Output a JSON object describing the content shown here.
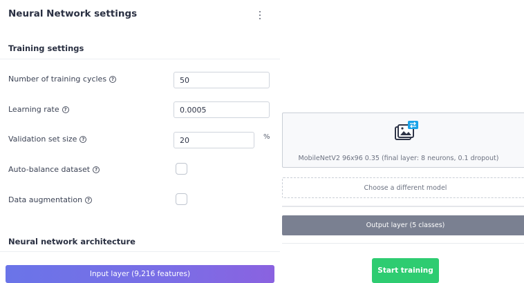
{
  "panel": {
    "title": "Neural Network settings",
    "training_section_title": "Training settings",
    "architecture_title": "Neural network architecture"
  },
  "fields": {
    "training_cycles": {
      "label": "Number of training cycles",
      "value": "50"
    },
    "learning_rate": {
      "label": "Learning rate",
      "value": "0.0005"
    },
    "validation_size": {
      "label": "Validation set size",
      "value": "20",
      "unit": "%"
    },
    "auto_balance": {
      "label": "Auto-balance dataset",
      "checked": false
    },
    "data_augmentation": {
      "label": "Data augmentation",
      "checked": false
    }
  },
  "help_glyph": "?",
  "architecture": {
    "input_layer": "Input layer (9,216 features)",
    "model_name": "MobileNetV2 96x96 0.35 (final layer: 8 neurons, 0.1 dropout)",
    "choose_model": "Choose a different model",
    "output_layer": "Output layer (5 classes)"
  },
  "actions": {
    "start_training": "Start training"
  },
  "colors": {
    "accent_green": "#2ecc71",
    "input_layer_start": "#6a74e8",
    "input_layer_end": "#8a62e0",
    "output_layer": "#7a8091",
    "model_icon_blue": "#1aa3e8"
  }
}
